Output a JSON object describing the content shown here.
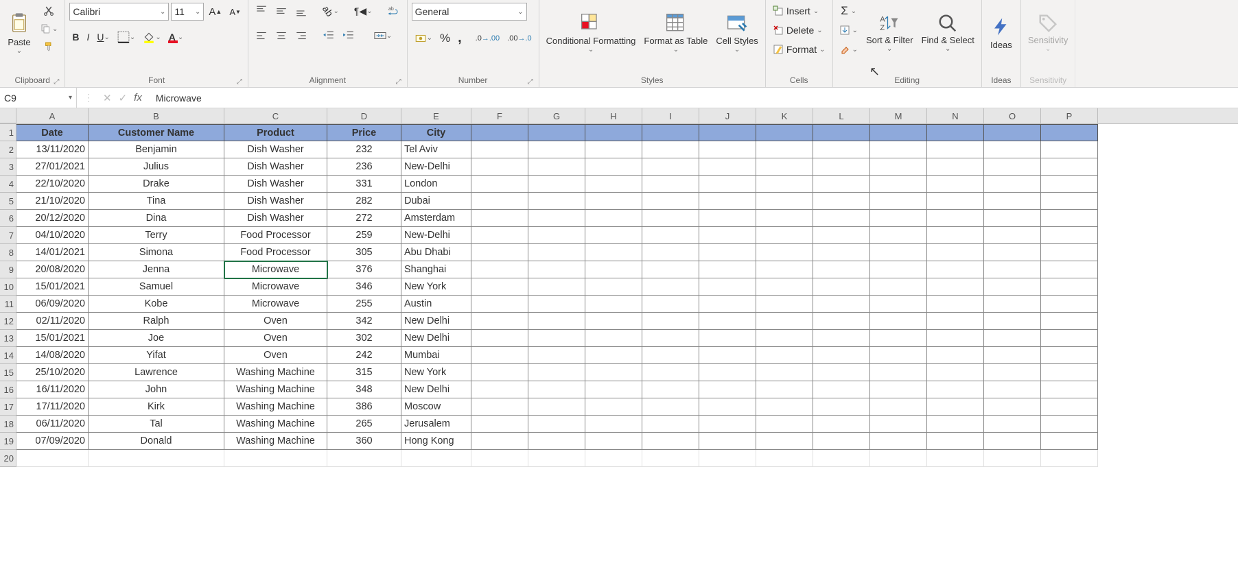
{
  "ribbon": {
    "clipboard": {
      "label": "Clipboard",
      "paste": "Paste"
    },
    "font": {
      "label": "Font",
      "family": "Calibri",
      "size": "11"
    },
    "alignment": {
      "label": "Alignment"
    },
    "number": {
      "label": "Number",
      "format": "General"
    },
    "styles": {
      "label": "Styles",
      "cond": "Conditional Formatting",
      "fmtTable": "Format as Table",
      "cellStyles": "Cell Styles"
    },
    "cells": {
      "label": "Cells",
      "insert": "Insert",
      "delete": "Delete",
      "format": "Format"
    },
    "editing": {
      "label": "Editing",
      "sort": "Sort & Filter",
      "find": "Find & Select"
    },
    "ideas": {
      "label": "Ideas",
      "ideas": "Ideas"
    },
    "sensitivity": {
      "label": "Sensitivity",
      "sens": "Sensitivity"
    }
  },
  "namebox": "C9",
  "formula": "Microwave",
  "columns": [
    "A",
    "B",
    "C",
    "D",
    "E",
    "F",
    "G",
    "H",
    "I",
    "J",
    "K",
    "L",
    "M",
    "N",
    "O",
    "P"
  ],
  "header": [
    "Date",
    "Customer Name",
    "Product",
    "Price",
    "City"
  ],
  "rows": [
    [
      "13/11/2020",
      "Benjamin",
      "Dish Washer",
      "232",
      "Tel Aviv"
    ],
    [
      "27/01/2021",
      "Julius",
      "Dish Washer",
      "236",
      "New-Delhi"
    ],
    [
      "22/10/2020",
      "Drake",
      "Dish Washer",
      "331",
      "London"
    ],
    [
      "21/10/2020",
      "Tina",
      "Dish Washer",
      "282",
      "Dubai"
    ],
    [
      "20/12/2020",
      "Dina",
      "Dish Washer",
      "272",
      "Amsterdam"
    ],
    [
      "04/10/2020",
      "Terry",
      "Food Processor",
      "259",
      "New-Delhi"
    ],
    [
      "14/01/2021",
      "Simona",
      "Food Processor",
      "305",
      "Abu Dhabi"
    ],
    [
      "20/08/2020",
      "Jenna",
      "Microwave",
      "376",
      "Shanghai"
    ],
    [
      "15/01/2021",
      "Samuel",
      "Microwave",
      "346",
      "New York"
    ],
    [
      "06/09/2020",
      "Kobe",
      "Microwave",
      "255",
      "Austin"
    ],
    [
      "02/11/2020",
      "Ralph",
      "Oven",
      "342",
      "New Delhi"
    ],
    [
      "15/01/2021",
      "Joe",
      "Oven",
      "302",
      "New Delhi"
    ],
    [
      "14/08/2020",
      "Yifat",
      "Oven",
      "242",
      "Mumbai"
    ],
    [
      "25/10/2020",
      "Lawrence",
      "Washing Machine",
      "315",
      "New York"
    ],
    [
      "16/11/2020",
      "John",
      "Washing Machine",
      "348",
      "New Delhi"
    ],
    [
      "17/11/2020",
      "Kirk",
      "Washing Machine",
      "386",
      "Moscow"
    ],
    [
      "06/11/2020",
      "Tal",
      "Washing Machine",
      "265",
      "Jerusalem"
    ],
    [
      "07/09/2020",
      "Donald",
      "Washing Machine",
      "360",
      "Hong Kong"
    ]
  ],
  "selected_cell": {
    "row": 9,
    "col": "C"
  }
}
